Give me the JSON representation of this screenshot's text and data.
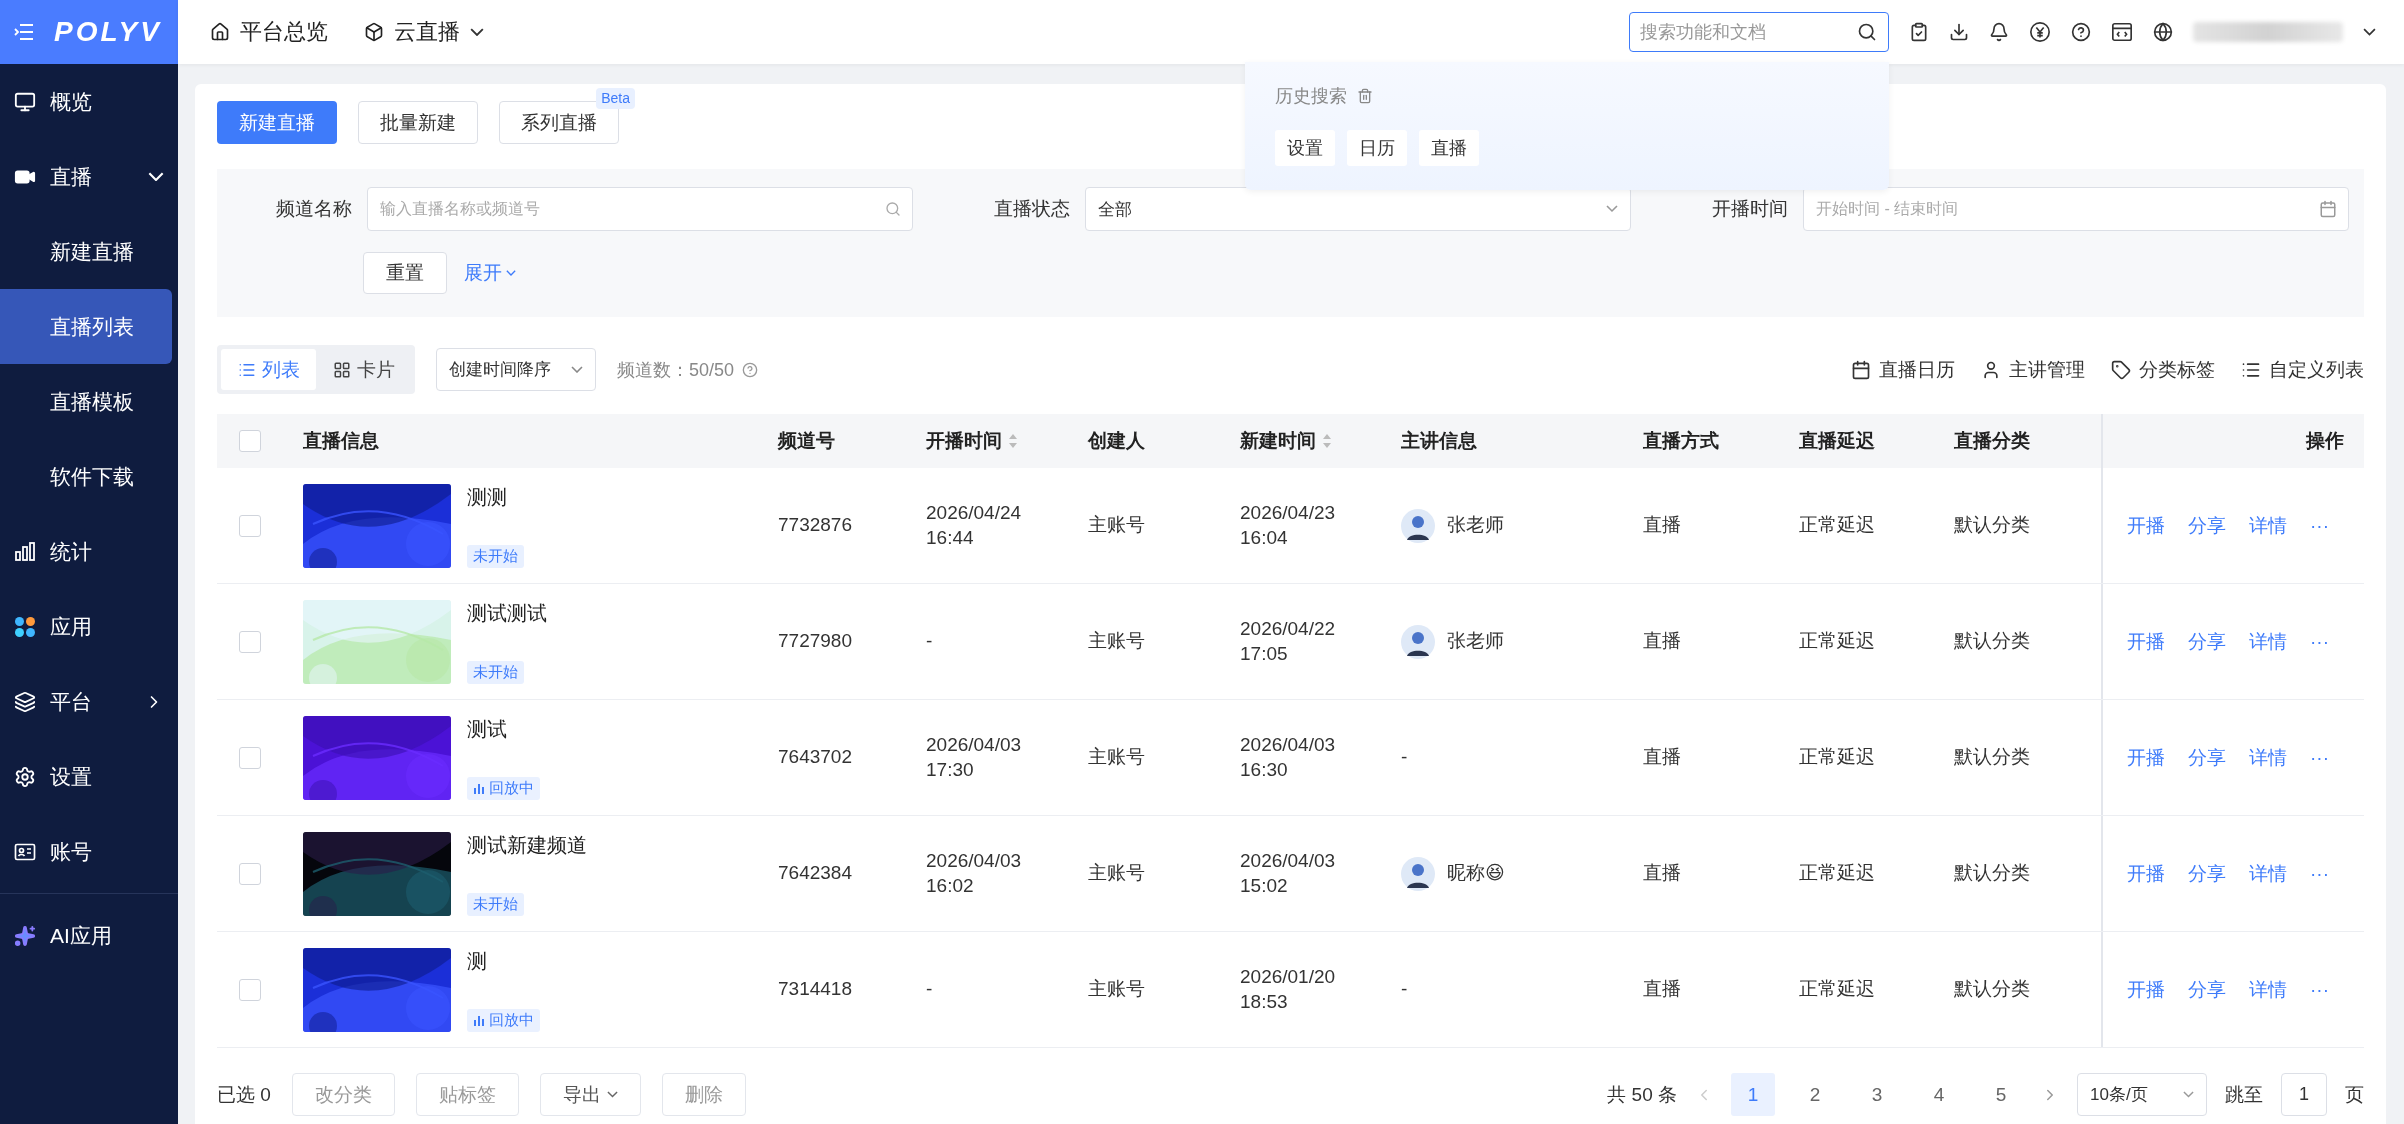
{
  "sidebar": {
    "logo": "POLYV",
    "items": [
      {
        "label": "概览",
        "selected": false
      },
      {
        "label": "直播",
        "selected": false,
        "expanded": true,
        "children": [
          {
            "label": "新建直播",
            "selected": false
          },
          {
            "label": "直播列表",
            "selected": true
          },
          {
            "label": "直播模板",
            "selected": false
          },
          {
            "label": "软件下载",
            "selected": false
          }
        ]
      },
      {
        "label": "统计",
        "selected": false
      },
      {
        "label": "应用",
        "selected": false
      },
      {
        "label": "平台",
        "selected": false,
        "expanded": false
      },
      {
        "label": "设置",
        "selected": false
      },
      {
        "label": "账号",
        "selected": false
      },
      {
        "label": "AI应用",
        "selected": false
      }
    ]
  },
  "topbar": {
    "nav": [
      {
        "label": "平台总览",
        "dropdown": false
      },
      {
        "label": "云直播",
        "dropdown": true
      }
    ],
    "search": {
      "placeholder": "搜索功能和文档"
    },
    "search_history": {
      "title": "历史搜索",
      "tags": [
        "设置",
        "日历",
        "直播"
      ]
    }
  },
  "actions": [
    {
      "label": "新建直播",
      "primary": true
    },
    {
      "label": "批量新建",
      "primary": false
    },
    {
      "label": "系列直播",
      "primary": false,
      "badge": "Beta"
    }
  ],
  "filters": {
    "fields": [
      {
        "label": "频道名称",
        "kind": "search",
        "placeholder": "输入直播名称或频道号"
      },
      {
        "label": "直播状态",
        "kind": "select",
        "value": "全部"
      },
      {
        "label": "开播时间",
        "kind": "date",
        "placeholder": "开始时间 - 结束时间"
      }
    ],
    "reset": "重置",
    "expand": "展开"
  },
  "toolbar": {
    "views": [
      {
        "label": "列表",
        "selected": true
      },
      {
        "label": "卡片",
        "selected": false
      }
    ],
    "sort": "创建时间降序",
    "count": "频道数：50/50",
    "tools": [
      "直播日历",
      "主讲管理",
      "分类标签",
      "自定义列表"
    ]
  },
  "table": {
    "select_all": {
      "checked": false
    },
    "columns": [
      {
        "label": "直播信息",
        "sortable": false
      },
      {
        "label": "频道号",
        "sortable": false
      },
      {
        "label": "开播时间",
        "sortable": true
      },
      {
        "label": "创建人",
        "sortable": false
      },
      {
        "label": "新建时间",
        "sortable": true
      },
      {
        "label": "主讲信息",
        "sortable": false
      },
      {
        "label": "直播方式",
        "sortable": false
      },
      {
        "label": "直播延迟",
        "sortable": false
      },
      {
        "label": "直播分类",
        "sortable": false
      },
      {
        "label": "操作",
        "sortable": false
      }
    ],
    "rows": [
      {
        "checked": false,
        "title": "测测",
        "status": {
          "label": "未开始",
          "kind": "pending"
        },
        "channel": "7732876",
        "start": "2026/04/24 16:44",
        "creator": "主账号",
        "created": "2026/04/23 16:04",
        "presenter": {
          "name": "张老师",
          "avatar": true
        },
        "mode": "直播",
        "latency": "正常延迟",
        "category": "默认分类",
        "ops": [
          "开播",
          "分享",
          "详情"
        ],
        "more": "···"
      },
      {
        "checked": false,
        "title": "测试测试",
        "status": {
          "label": "未开始",
          "kind": "pending"
        },
        "channel": "7727980",
        "start": "-",
        "creator": "主账号",
        "created": "2026/04/22 17:05",
        "presenter": {
          "name": "张老师",
          "avatar": true
        },
        "mode": "直播",
        "latency": "正常延迟",
        "category": "默认分类",
        "ops": [
          "开播",
          "分享",
          "详情"
        ],
        "more": "···"
      },
      {
        "checked": false,
        "title": "测试",
        "status": {
          "label": "回放中",
          "kind": "replay"
        },
        "channel": "7643702",
        "start": "2026/04/03 17:30",
        "creator": "主账号",
        "created": "2026/04/03 16:30",
        "presenter": {
          "name": "-",
          "avatar": false
        },
        "mode": "直播",
        "latency": "正常延迟",
        "category": "默认分类",
        "ops": [
          "开播",
          "分享",
          "详情"
        ],
        "more": "···"
      },
      {
        "checked": false,
        "title": "测试新建频道",
        "status": {
          "label": "未开始",
          "kind": "pending"
        },
        "channel": "7642384",
        "start": "2026/04/03 16:02",
        "creator": "主账号",
        "created": "2026/04/03 15:02",
        "presenter": {
          "name": "昵称😆",
          "avatar": true
        },
        "mode": "直播",
        "latency": "正常延迟",
        "category": "默认分类",
        "ops": [
          "开播",
          "分享",
          "详情"
        ],
        "more": "···"
      },
      {
        "checked": false,
        "title": "测",
        "status": {
          "label": "回放中",
          "kind": "replay"
        },
        "channel": "7314418",
        "start": "-",
        "creator": "主账号",
        "created": "2026/01/20 18:53",
        "presenter": {
          "name": "-",
          "avatar": false
        },
        "mode": "直播",
        "latency": "正常延迟",
        "category": "默认分类",
        "ops": [
          "开播",
          "分享",
          "详情"
        ],
        "more": "···"
      }
    ]
  },
  "footer": {
    "selected": "已选 0",
    "buttons": [
      {
        "label": "改分类",
        "disabled": true,
        "dropdown": false
      },
      {
        "label": "贴标签",
        "disabled": true,
        "dropdown": false
      },
      {
        "label": "导出",
        "disabled": false,
        "dropdown": true
      },
      {
        "label": "删除",
        "disabled": true,
        "dropdown": false
      }
    ],
    "total": "共 50 条",
    "pages": [
      {
        "label": "1",
        "selected": true
      },
      {
        "label": "2",
        "selected": false
      },
      {
        "label": "3",
        "selected": false
      },
      {
        "label": "4",
        "selected": false
      },
      {
        "label": "5",
        "selected": false
      }
    ],
    "page_size": "10条/页",
    "jump_label": "跳至",
    "jump_value": "1",
    "jump_unit": "页"
  }
}
